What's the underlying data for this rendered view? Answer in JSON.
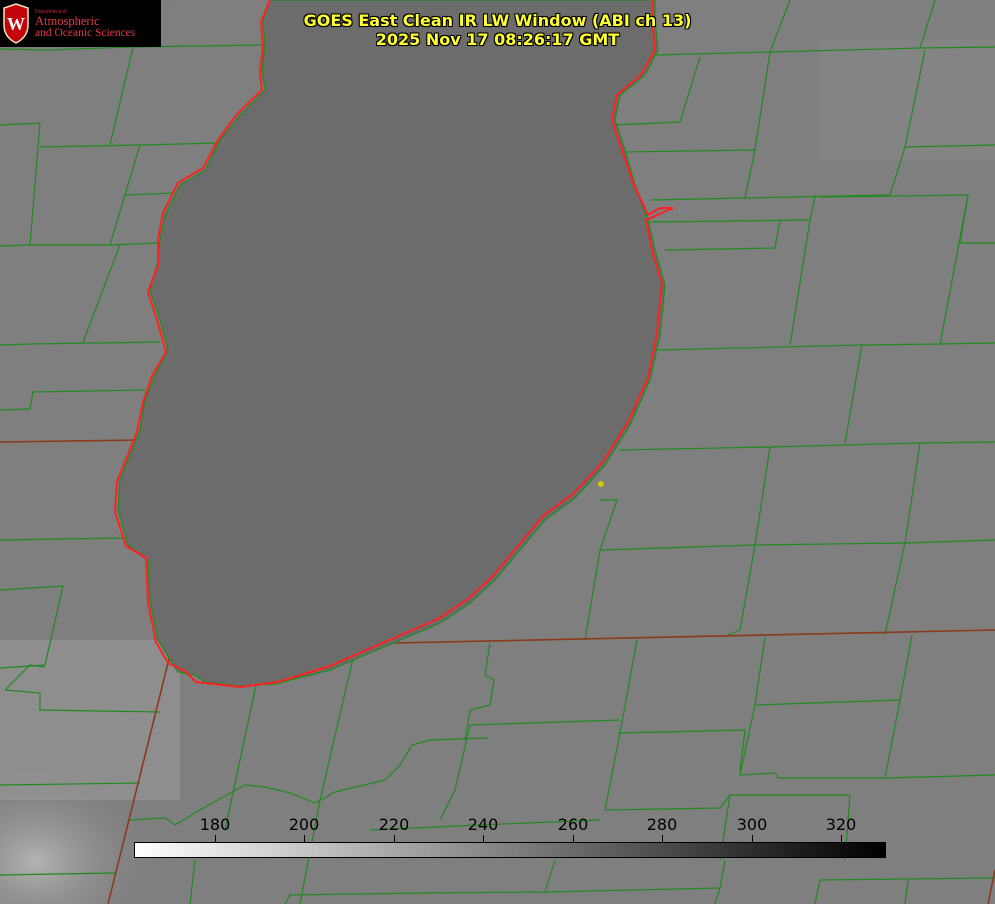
{
  "title": {
    "line1": "GOES East Clean IR LW Window (ABI ch 13)",
    "line2": "2025 Nov 17 08:26:17 GMT"
  },
  "logo": {
    "small_text": "Department of",
    "line1": "Atmospheric",
    "line2": "and Oceanic Sciences",
    "seal_letter": "W"
  },
  "colorbar": {
    "ticks": [
      "180",
      "200",
      "220",
      "240",
      "260",
      "280",
      "300",
      "320"
    ]
  },
  "colors": {
    "county_lines": "#1f8a1f",
    "coastline": "#ff2020",
    "state_lines": "#8b3a1a",
    "title_text": "#ffff33",
    "lake": "#6e6e6e",
    "land": "#7f7f7f",
    "marker": "#cccc00"
  }
}
